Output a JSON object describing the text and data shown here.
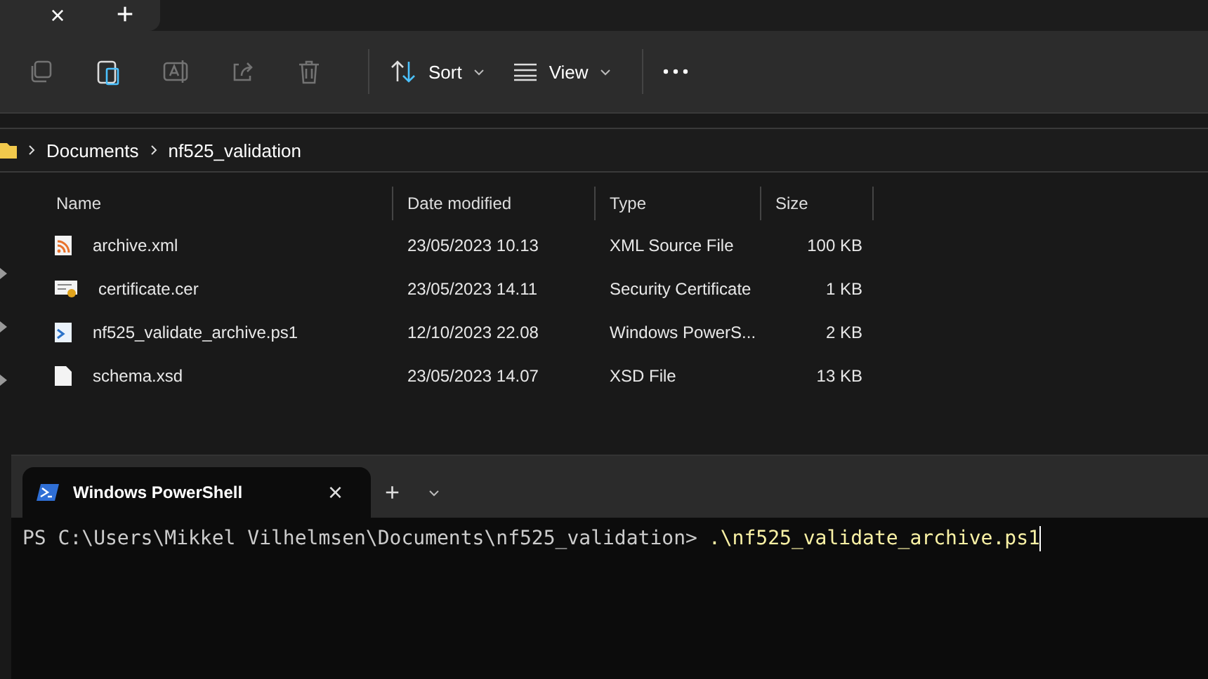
{
  "explorer": {
    "tabs": [
      {
        "label": "×",
        "kind": "close"
      },
      {
        "label": "+",
        "kind": "new"
      }
    ],
    "toolbar": [
      {
        "kind": "copy",
        "disabled": true
      },
      {
        "kind": "paste",
        "disabled": false
      },
      {
        "kind": "rename",
        "disabled": true
      },
      {
        "kind": "share",
        "disabled": true
      },
      {
        "kind": "delete",
        "disabled": true
      },
      {
        "kind": "sort",
        "label": "Sort",
        "disabled": false
      },
      {
        "kind": "view",
        "label": "View",
        "disabled": false
      },
      {
        "kind": "more",
        "disabled": false
      }
    ],
    "breadcrumb": [
      "Documents",
      "nf525_validation"
    ],
    "columns": [
      "Name",
      "Date modified",
      "Type",
      "Size"
    ],
    "rows": [
      {
        "kind": "xml",
        "name": "archive.xml",
        "date": "23/05/2023 10.13",
        "type": "XML Source File",
        "size": "100 KB"
      },
      {
        "kind": "cert",
        "name": "certificate.cer",
        "date": "23/05/2023 14.11",
        "type": "Security Certificate",
        "size": "1 KB"
      },
      {
        "kind": "ps",
        "name": "nf525_validate_archive.ps1",
        "date": "12/10/2023 22.08",
        "type": "Windows PowerS...",
        "size": "2 KB"
      },
      {
        "kind": "file",
        "name": "schema.xsd",
        "date": "23/05/2023 14.07",
        "type": "XSD File",
        "size": "13 KB"
      }
    ]
  },
  "terminal": {
    "tab": {
      "title": "Windows PowerShell",
      "close": "×"
    },
    "new_tab": "+",
    "prompt": "PS C:\\Users\\Mikkel Vilhelmsen\\Documents\\nf525_validation>",
    "command": ".\\nf525_validate_archive.ps1"
  }
}
